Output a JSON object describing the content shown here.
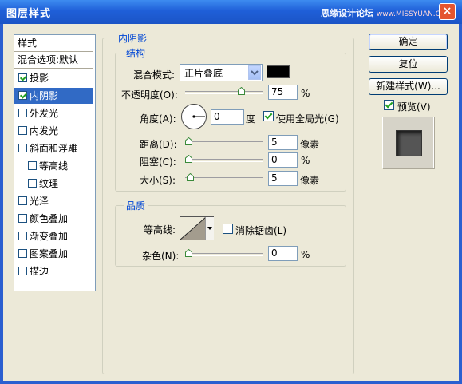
{
  "window": {
    "title": "图层样式",
    "watermark_text": "思缘设计论坛",
    "watermark_url": "www.MISSYUAN.COM",
    "close_label": "×"
  },
  "style_list": {
    "items": [
      {
        "label": "样式",
        "checkbox": false,
        "checked": false,
        "selected": false,
        "indent": false
      },
      {
        "label": "混合选项:默认",
        "checkbox": false,
        "checked": false,
        "selected": false,
        "indent": false
      },
      {
        "label": "投影",
        "checkbox": true,
        "checked": true,
        "selected": false,
        "indent": false
      },
      {
        "label": "内阴影",
        "checkbox": true,
        "checked": true,
        "selected": true,
        "indent": false
      },
      {
        "label": "外发光",
        "checkbox": true,
        "checked": false,
        "selected": false,
        "indent": false
      },
      {
        "label": "内发光",
        "checkbox": true,
        "checked": false,
        "selected": false,
        "indent": false
      },
      {
        "label": "斜面和浮雕",
        "checkbox": true,
        "checked": false,
        "selected": false,
        "indent": false
      },
      {
        "label": "等高线",
        "checkbox": true,
        "checked": false,
        "selected": false,
        "indent": true
      },
      {
        "label": "纹理",
        "checkbox": true,
        "checked": false,
        "selected": false,
        "indent": true
      },
      {
        "label": "光泽",
        "checkbox": true,
        "checked": false,
        "selected": false,
        "indent": false
      },
      {
        "label": "颜色叠加",
        "checkbox": true,
        "checked": false,
        "selected": false,
        "indent": false
      },
      {
        "label": "渐变叠加",
        "checkbox": true,
        "checked": false,
        "selected": false,
        "indent": false
      },
      {
        "label": "图案叠加",
        "checkbox": true,
        "checked": false,
        "selected": false,
        "indent": false
      },
      {
        "label": "描边",
        "checkbox": true,
        "checked": false,
        "selected": false,
        "indent": false
      }
    ]
  },
  "inner_shadow": {
    "section_title": "内阴影",
    "structure": {
      "title": "结构",
      "blend_mode_label": "混合模式:",
      "blend_mode_value": "正片叠底",
      "blend_color": "#000000",
      "opacity_label": "不透明度(O):",
      "opacity_value": "75",
      "opacity_fraction": 0.75,
      "opacity_unit": "%",
      "angle_label": "角度(A):",
      "angle_value": "0",
      "angle_unit": "度",
      "global_light_label": "使用全局光(G)",
      "global_light_checked": true,
      "distance_label": "距离(D):",
      "distance_value": "5",
      "distance_unit": "像素",
      "distance_fraction": 0.0,
      "choke_label": "阻塞(C):",
      "choke_value": "0",
      "choke_unit": "%",
      "choke_fraction": 0.0,
      "size_label": "大小(S):",
      "size_value": "5",
      "size_unit": "像素",
      "size_fraction": 0.02
    },
    "quality": {
      "title": "品质",
      "contour_label": "等高线:",
      "anti_alias_label": "消除锯齿(L)",
      "anti_alias_checked": false,
      "noise_label": "杂色(N):",
      "noise_value": "0",
      "noise_unit": "%",
      "noise_fraction": 0.0
    }
  },
  "buttons": {
    "ok": "确定",
    "reset": "复位",
    "new_style": "新建样式(W)...",
    "preview_label": "预览(V)",
    "preview_checked": true
  }
}
